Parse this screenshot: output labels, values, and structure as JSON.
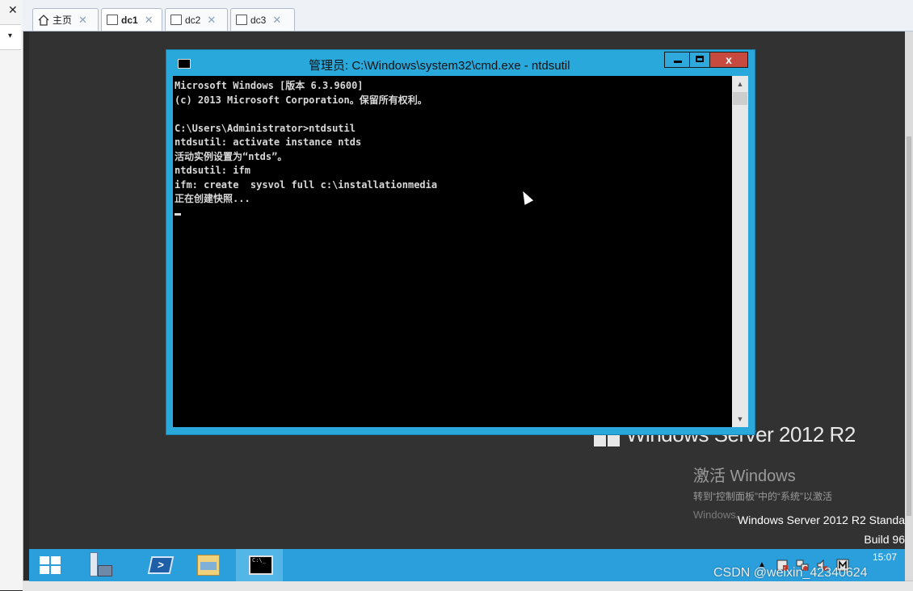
{
  "left_panel": {
    "close_glyph": "✕",
    "dropdown_glyph": "▾"
  },
  "tabs": [
    {
      "label": "主页",
      "icon": "home-icon",
      "close": "✕"
    },
    {
      "label": "dc1",
      "icon": "vm-icon",
      "close": "✕",
      "active": true
    },
    {
      "label": "dc2",
      "icon": "vm-icon",
      "close": "✕"
    },
    {
      "label": "dc3",
      "icon": "vm-icon",
      "close": "✕"
    }
  ],
  "cmd_window": {
    "title": "管理员: C:\\Windows\\system32\\cmd.exe - ntdsutil",
    "close_glyph": "x",
    "lines": [
      "Microsoft Windows [版本 6.3.9600]",
      "(c) 2013 Microsoft Corporation。保留所有权利。",
      "",
      "C:\\Users\\Administrator>ntdsutil",
      "ntdsutil: activate instance ntds",
      "活动实例设置为“ntds”。",
      "ntdsutil: ifm",
      "ifm: create  sysvol full c:\\installationmedia",
      "正在创建快照..."
    ],
    "scroll_up": "▲",
    "scroll_down": "▼"
  },
  "desktop": {
    "watermark_logo_text": "Windows Server 2012 R2",
    "activate_title": "激活 Windows",
    "activate_hint": "转到“控制面板”中的“系统”以激活",
    "activate_hint_2": "Windows。",
    "edition": "Windows Server 2012 R2 Standa",
    "build": "Build 96"
  },
  "taskbar": {
    "items": [
      "start-button",
      "server-manager",
      "powershell",
      "file-explorer",
      "command-prompt"
    ],
    "clock_time": "15:07",
    "accent": "#2b9fdc"
  },
  "watermark": "CSDN @weixin_42340624"
}
